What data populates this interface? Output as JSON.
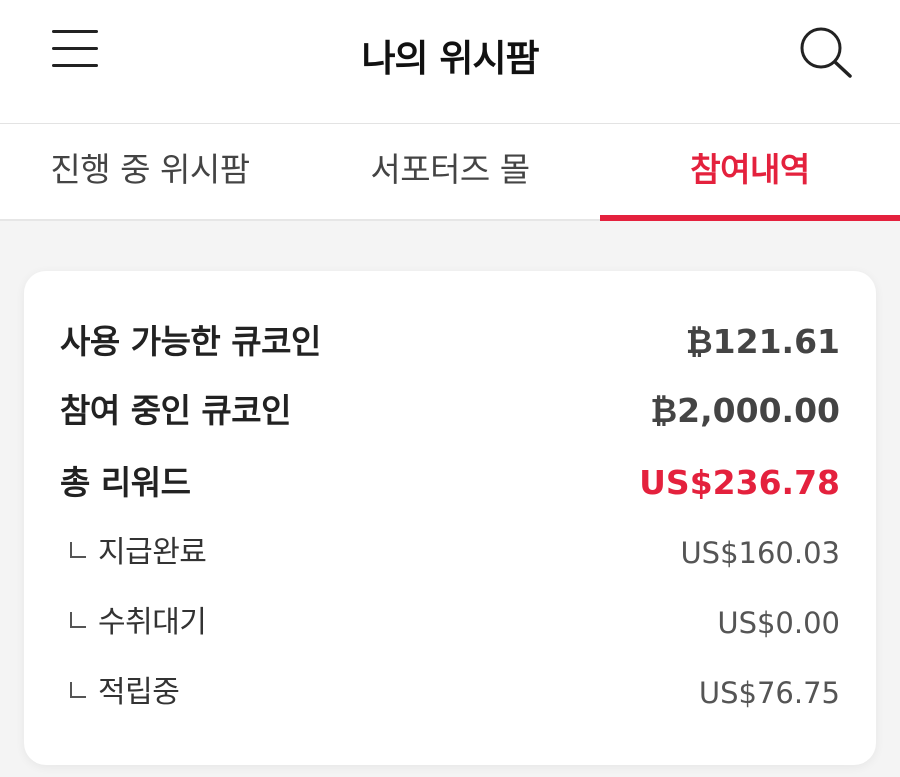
{
  "header": {
    "title": "나의 위시팜",
    "menu_icon": "hamburger-menu-icon",
    "search_icon": "search-icon"
  },
  "tabs": [
    {
      "label": "진행 중 위시팜",
      "active": false
    },
    {
      "label": "서포터즈 몰",
      "active": false
    },
    {
      "label": "참여내역",
      "active": true
    }
  ],
  "summary": {
    "available_coin": {
      "label": "사용 가능한 큐코인",
      "value": "₿121.61"
    },
    "participating_coin": {
      "label": "참여 중인 큐코인",
      "value": "₿2,000.00"
    },
    "total_reward": {
      "label": "총 리워드",
      "value": "US$236.78"
    },
    "breakdown": [
      {
        "label": "지급완료",
        "value": "US$160.03"
      },
      {
        "label": "수취대기",
        "value": "US$0.00"
      },
      {
        "label": "적립중",
        "value": "US$76.75"
      }
    ]
  },
  "colors": {
    "accent": "#e4213d",
    "background": "#f4f4f4",
    "card": "#ffffff"
  }
}
